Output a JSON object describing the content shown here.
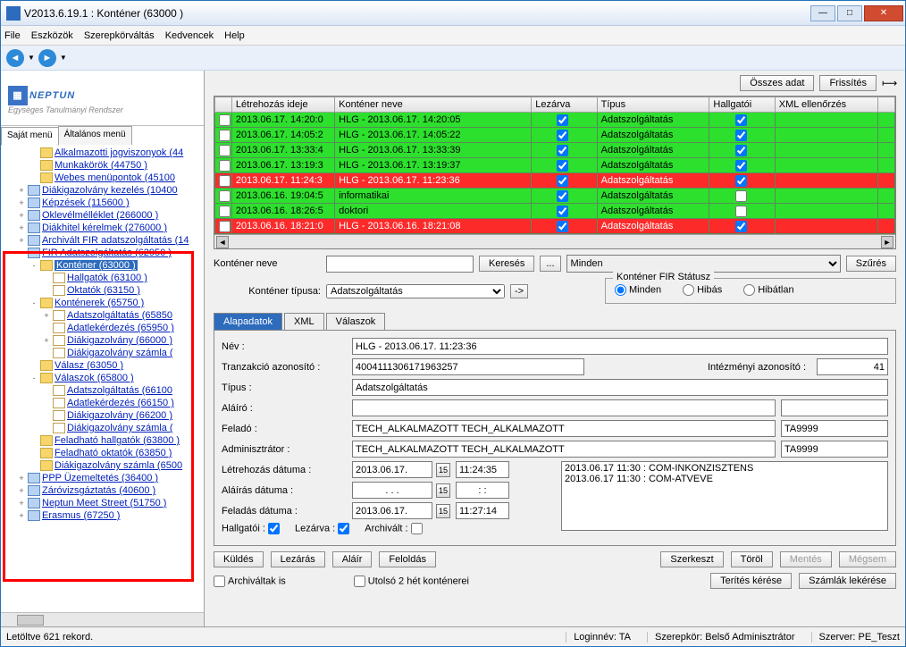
{
  "window": {
    "title": "V2013.6.19.1 : Konténer (63000  )"
  },
  "menubar": [
    "File",
    "Eszközök",
    "Szerepkörváltás",
    "Kedvencek",
    "Help"
  ],
  "logo": {
    "brand": "NEPTUN",
    "sub": "Egységes Tanulmányi Rendszer"
  },
  "lefttabs": {
    "active": "Saját menü",
    "other": "Általános menü"
  },
  "tree": [
    {
      "d": 2,
      "e": "",
      "i": "folder",
      "t": "Alkalmazotti jogviszonyok (44"
    },
    {
      "d": 2,
      "e": "",
      "i": "folder",
      "t": "Munkakörök (44750  )"
    },
    {
      "d": 2,
      "e": "",
      "i": "folder",
      "t": "Webes menüpontok (45100"
    },
    {
      "d": 1,
      "e": "+",
      "i": "blue",
      "t": "Diákigazolvány kezelés (10400"
    },
    {
      "d": 1,
      "e": "+",
      "i": "blue",
      "t": "Képzések (115600  )"
    },
    {
      "d": 1,
      "e": "+",
      "i": "blue",
      "t": "Oklevélmélléklet (266000  )"
    },
    {
      "d": 1,
      "e": "+",
      "i": "blue",
      "t": "Diákhitel kérelmek (276000  )"
    },
    {
      "d": 1,
      "e": "+",
      "i": "blue",
      "t": "Archivált FIR adatszolgáltatás (14"
    },
    {
      "d": 1,
      "e": "-",
      "i": "blue",
      "t": "FIR Adatszolgáltatás (62950  )"
    },
    {
      "d": 2,
      "e": "-",
      "i": "folder",
      "t": "Konténer (63000  )",
      "sel": true
    },
    {
      "d": 3,
      "e": "",
      "i": "page",
      "t": "Hallgatók (63100  )"
    },
    {
      "d": 3,
      "e": "",
      "i": "page",
      "t": "Oktatók (63150  )"
    },
    {
      "d": 2,
      "e": "-",
      "i": "folder",
      "t": "Konténerek (65750  )"
    },
    {
      "d": 3,
      "e": "+",
      "i": "page",
      "t": "Adatszolgáltatás (65850"
    },
    {
      "d": 3,
      "e": "",
      "i": "page",
      "t": "Adatlekérdezés (65950  )"
    },
    {
      "d": 3,
      "e": "+",
      "i": "page",
      "t": "Diákigazolvány (66000  )"
    },
    {
      "d": 3,
      "e": "",
      "i": "page",
      "t": "Diákigazolvány számla ("
    },
    {
      "d": 2,
      "e": "",
      "i": "folder",
      "t": "Válasz (63050  )"
    },
    {
      "d": 2,
      "e": "-",
      "i": "folder",
      "t": "Válaszok (65800  )"
    },
    {
      "d": 3,
      "e": "",
      "i": "page",
      "t": "Adatszolgáltatás (66100"
    },
    {
      "d": 3,
      "e": "",
      "i": "page",
      "t": "Adatlekérdezés (66150  )"
    },
    {
      "d": 3,
      "e": "",
      "i": "page",
      "t": "Diákigazolvány (66200  )"
    },
    {
      "d": 3,
      "e": "",
      "i": "page",
      "t": "Diákigazolvány számla ("
    },
    {
      "d": 2,
      "e": "",
      "i": "folder",
      "t": "Feladható hallgatók (63800  )"
    },
    {
      "d": 2,
      "e": "",
      "i": "folder",
      "t": "Feladható oktatók (63850  )"
    },
    {
      "d": 2,
      "e": "",
      "i": "folder",
      "t": "Diákigazolvány számla (6500"
    },
    {
      "d": 1,
      "e": "+",
      "i": "blue",
      "t": "PPP Üzemeltetés (36400  )"
    },
    {
      "d": 1,
      "e": "+",
      "i": "blue",
      "t": "Záróvizsgáztatás (40600  )"
    },
    {
      "d": 1,
      "e": "+",
      "i": "blue",
      "t": "Neptun Meet Street (51750  )"
    },
    {
      "d": 1,
      "e": "+",
      "i": "blue",
      "t": "Erasmus (67250  )"
    }
  ],
  "rtoolbar": {
    "all": "Összes adat",
    "refresh": "Frissítés"
  },
  "grid": {
    "headers": [
      "",
      "Létrehozás ideje",
      "Konténer neve",
      "Lezárva",
      "Típus",
      "Hallgatói",
      "XML ellenőrzés",
      ""
    ],
    "rows": [
      {
        "c": "green",
        "time": "2013.06.17. 14:20:0",
        "name": "HLG - 2013.06.17. 14:20:05",
        "locked": true,
        "type": "Adatszolgáltatás",
        "student": true
      },
      {
        "c": "green",
        "time": "2013.06.17. 14:05:2",
        "name": "HLG - 2013.06.17. 14:05:22",
        "locked": true,
        "type": "Adatszolgáltatás",
        "student": true
      },
      {
        "c": "green",
        "time": "2013.06.17. 13:33:4",
        "name": "HLG - 2013.06.17. 13:33:39",
        "locked": true,
        "type": "Adatszolgáltatás",
        "student": true
      },
      {
        "c": "green",
        "time": "2013.06.17. 13:19:3",
        "name": "HLG - 2013.06.17. 13:19:37",
        "locked": true,
        "type": "Adatszolgáltatás",
        "student": true
      },
      {
        "c": "red",
        "time": "2013.06.17. 11:24:3",
        "name": "HLG - 2013.06.17. 11:23:36",
        "locked": true,
        "type": "Adatszolgáltatás",
        "student": true
      },
      {
        "c": "green",
        "time": "2013.06.16. 19:04:5",
        "name": "informatikai",
        "locked": true,
        "type": "Adatszolgáltatás",
        "student": false
      },
      {
        "c": "green",
        "time": "2013.06.16. 18:26:5",
        "name": "doktori",
        "locked": true,
        "type": "Adatszolgáltatás",
        "student": false
      },
      {
        "c": "red",
        "time": "2013.06.16. 18:21:0",
        "name": "HLG - 2013.06.16. 18:21:08",
        "locked": true,
        "type": "Adatszolgáltatás",
        "student": true
      }
    ]
  },
  "search": {
    "label": "Konténer neve",
    "btn": "Keresés",
    "ellipsis": "...",
    "all": "Minden",
    "filter": "Szűrés"
  },
  "typeRow": {
    "label": "Konténer típusa:",
    "value": "Adatszolgáltatás",
    "btn": "->"
  },
  "statusGroup": {
    "title": "Konténer FIR Státusz",
    "opts": [
      "Minden",
      "Hibás",
      "Hibátlan"
    ]
  },
  "detailTabs": [
    "Alapadatok",
    "XML",
    "Válaszok"
  ],
  "form": {
    "name_l": "Név :",
    "name_v": "HLG - 2013.06.17. 11:23:36",
    "tran_l": "Tranzakció azonosító :",
    "tran_v": "4004111306171963257",
    "inst_l": "Intézményi azonosító :",
    "inst_v": "41",
    "type_l": "Típus :",
    "type_v": "Adatszolgáltatás",
    "signer_l": "Aláíró :",
    "signer_v": "",
    "signer_v2": "",
    "sender_l": "Feladó :",
    "sender_v": "TECH_ALKALMAZOTT TECH_ALKALMAZOTT",
    "sender_v2": "TA9999",
    "admin_l": "Adminisztrátor :",
    "admin_v": "TECH_ALKALMAZOTT TECH_ALKALMAZOTT",
    "admin_v2": "TA9999",
    "create_l": "Létrehozás dátuma :",
    "create_d": "2013.06.17.",
    "create_t": "11:24:35",
    "signd_l": "Aláírás dátuma :",
    "signd_d": ". . .",
    "signd_t": ": :",
    "sendd_l": "Feladás dátuma :",
    "sendd_d": "2013.06.17.",
    "sendd_t": "11:27:14",
    "student_l": "Hallgatói :",
    "locked_l": "Lezárva :",
    "archived_l": "Archivált :",
    "log": "2013.06.17 11:30 : COM-INKONZISZTENS\n2013.06.17 11:30 : COM-ATVEVE"
  },
  "actions1": [
    "Küldés",
    "Lezárás",
    "Aláír",
    "Feloldás"
  ],
  "actions2": [
    "Szerkeszt",
    "Töröl",
    "Mentés",
    "Mégsem"
  ],
  "chk_archived": "Archiváltak is",
  "chk_last2w": "Utolsó 2 hét konténerei",
  "actions3": [
    "Terítés kérése",
    "Számlák lekérése"
  ],
  "status": {
    "left": "Letöltve 621 rekord.",
    "login": "Loginnév: TA",
    "role": "Szerepkör: Belső Adminisztrátor",
    "server": "Szerver: PE_Teszt"
  }
}
